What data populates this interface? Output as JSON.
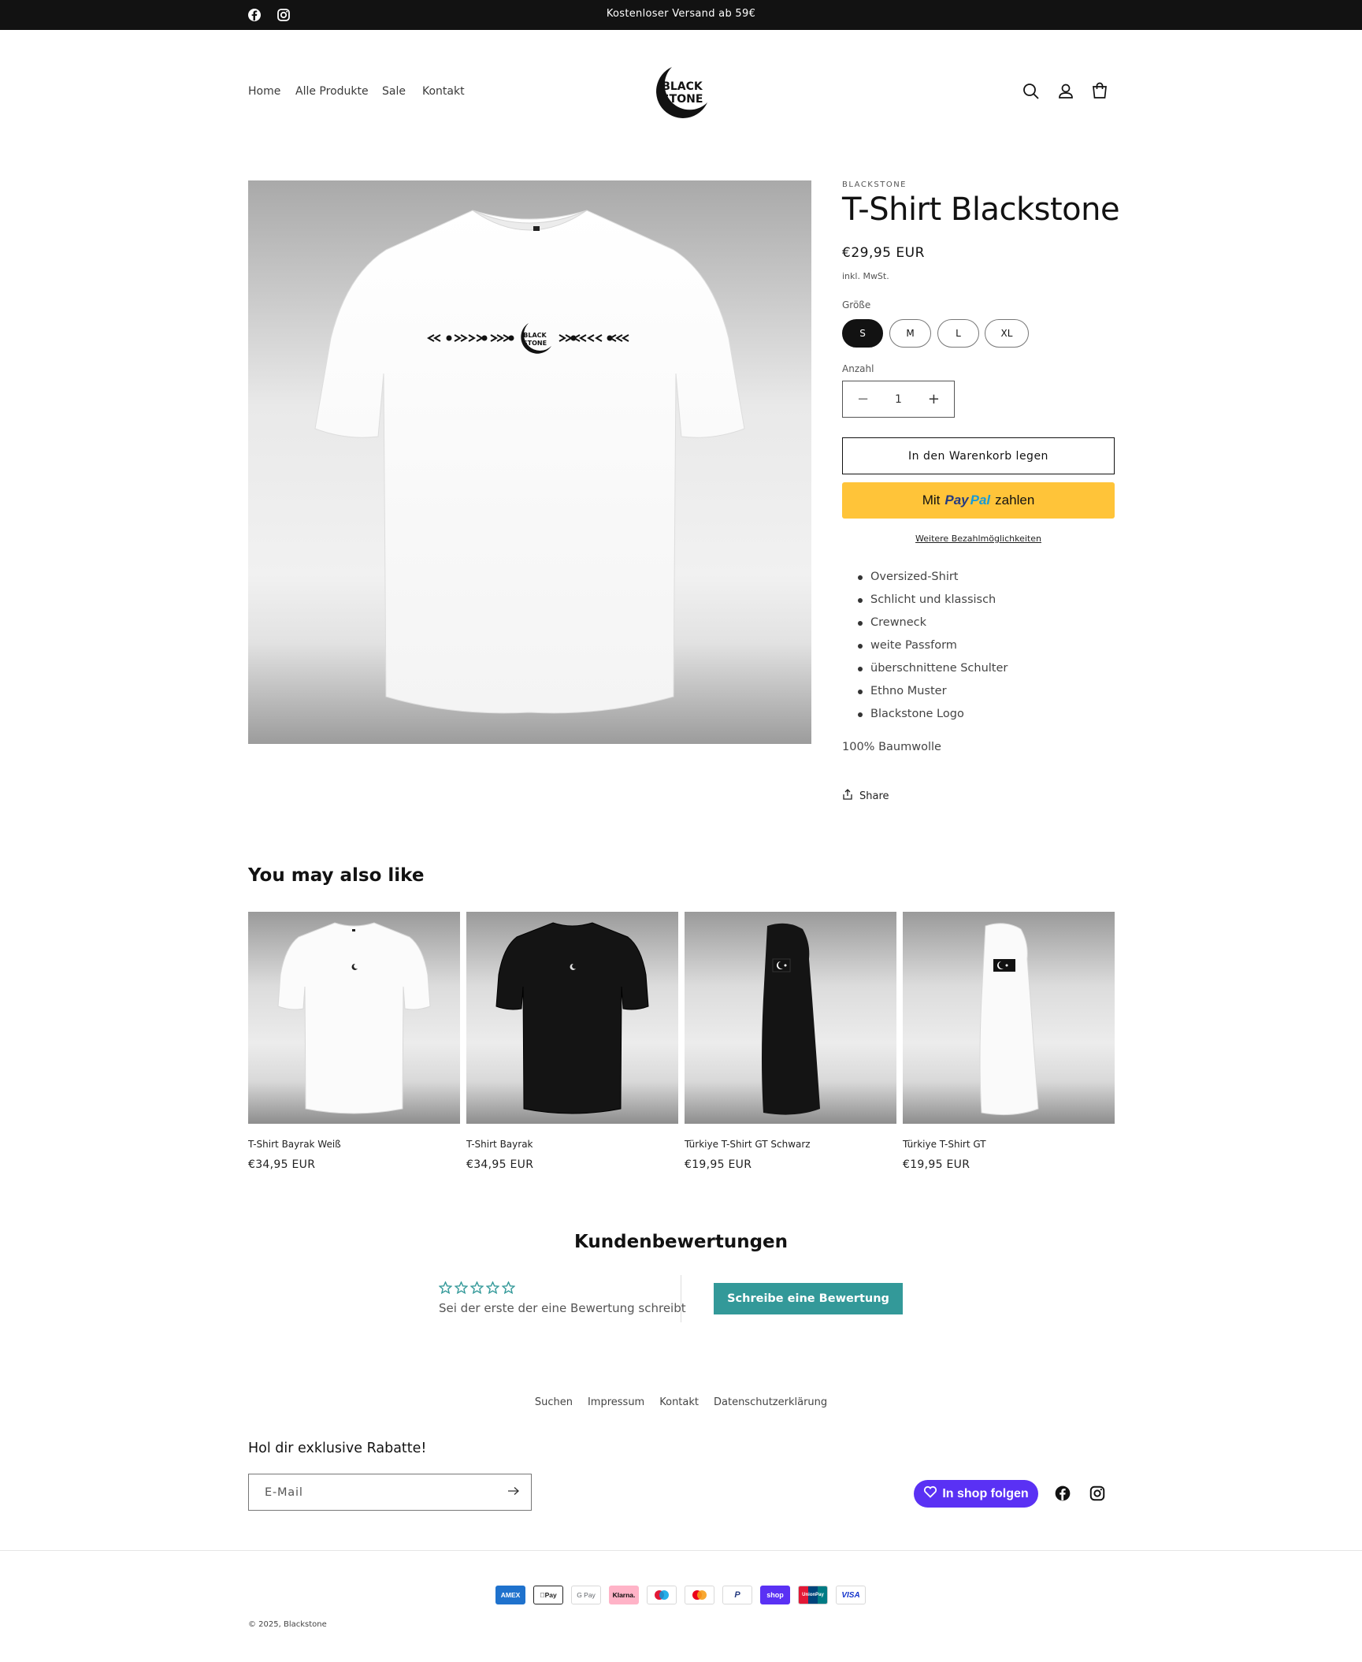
{
  "announcement": {
    "text": "Kostenloser Versand ab 59€"
  },
  "header": {
    "nav": [
      "Home",
      "Alle Produkte",
      "Sale",
      "Kontakt"
    ],
    "logo_text_line1": "BLACK",
    "logo_text_line2": "STONE"
  },
  "product": {
    "vendor": "BLACKSTONE",
    "title": "T-Shirt Blackstone",
    "price": "€29,95 EUR",
    "tax_note": "inkl. MwSt.",
    "size_label": "Größe",
    "sizes": [
      "S",
      "M",
      "L",
      "XL"
    ],
    "selected_size": "S",
    "quantity_label": "Anzahl",
    "quantity": "1",
    "add_to_cart": "In den Warenkorb legen",
    "paypal": {
      "prefix": "Mit",
      "brand1": "Pay",
      "brand2": "Pal",
      "suffix": "zahlen"
    },
    "more_payment": "Weitere Bezahlmöglichkeiten",
    "features": [
      "Oversized-Shirt",
      "Schlicht und klassisch",
      "Crewneck",
      "weite Passform",
      "überschnittene Schulter",
      "Ethno Muster",
      "Blackstone Logo"
    ],
    "material": "100% Baumwolle",
    "share": "Share"
  },
  "recommendations": {
    "title": "You may also like",
    "items": [
      {
        "name": "T-Shirt Bayrak Weiß",
        "price": "€34,95 EUR"
      },
      {
        "name": "T-Shirt Bayrak",
        "price": "€34,95 EUR"
      },
      {
        "name": "Türkiye T-Shirt GT Schwarz",
        "price": "€19,95 EUR"
      },
      {
        "name": "Türkiye T-Shirt GT",
        "price": "€19,95 EUR"
      }
    ]
  },
  "reviews": {
    "title": "Kundenbewertungen",
    "rating": 0,
    "empty_text": "Sei der erste der eine Bewertung schreibt",
    "write_button": "Schreibe eine Bewertung",
    "accent_color": "#339999"
  },
  "footer": {
    "links": [
      "Suchen",
      "Impressum",
      "Kontakt",
      "Datenschutzerklärung"
    ],
    "newsletter_title": "Hol dir exklusive Rabatte!",
    "email_placeholder": "E-Mail",
    "follow_button": "In shop folgen",
    "payment_methods": [
      "American Express",
      "Apple Pay",
      "Google Pay",
      "Klarna",
      "Maestro",
      "Mastercard",
      "PayPal",
      "Shop Pay",
      "Union Pay",
      "Visa"
    ],
    "payment_labels": [
      "AMEX",
      "Pay",
      "G Pay",
      "Klarna.",
      "",
      "",
      "P",
      "shop",
      "UnionPay",
      "VISA"
    ],
    "copyright": "© 2025, Blackstone"
  }
}
